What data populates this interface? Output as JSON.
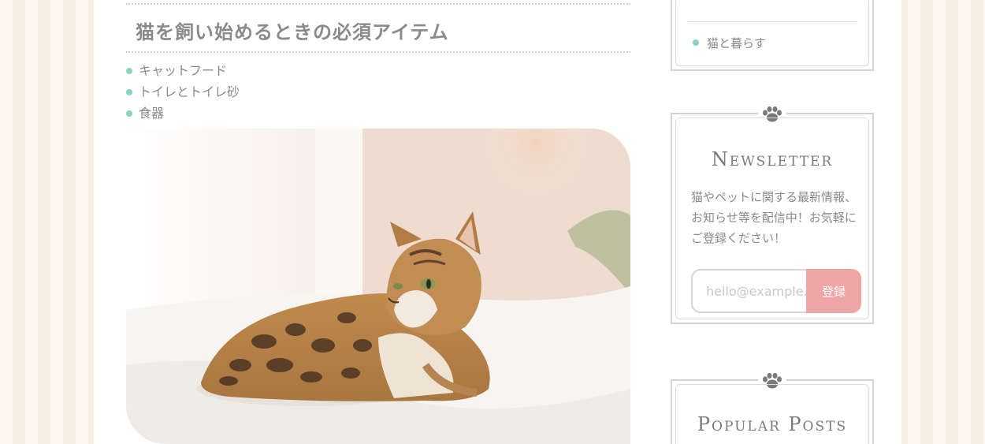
{
  "article": {
    "heading": "猫を飼い始めるときの必須アイテム",
    "items": [
      "キャットフード",
      "トイレとトイレ砂",
      "食器"
    ],
    "image_alt": "bengal-cat-lying-on-bed"
  },
  "sidebar": {
    "categories": {
      "items": [
        "猫と暮らす"
      ]
    },
    "newsletter": {
      "title": "Newsletter",
      "text": "猫やペットに関する最新情報、お知らせ等を配信中！お気軽にご登録ください！",
      "email_placeholder": "hello@example.com",
      "submit_label": "登録"
    },
    "popular": {
      "title": "Popular Posts"
    }
  },
  "colors": {
    "accent_teal": "#86d2c6",
    "button_pink": "#efa5a6",
    "text_gray": "#8a8a8a"
  },
  "icons": {
    "widget_ornament": "paw-icon"
  }
}
